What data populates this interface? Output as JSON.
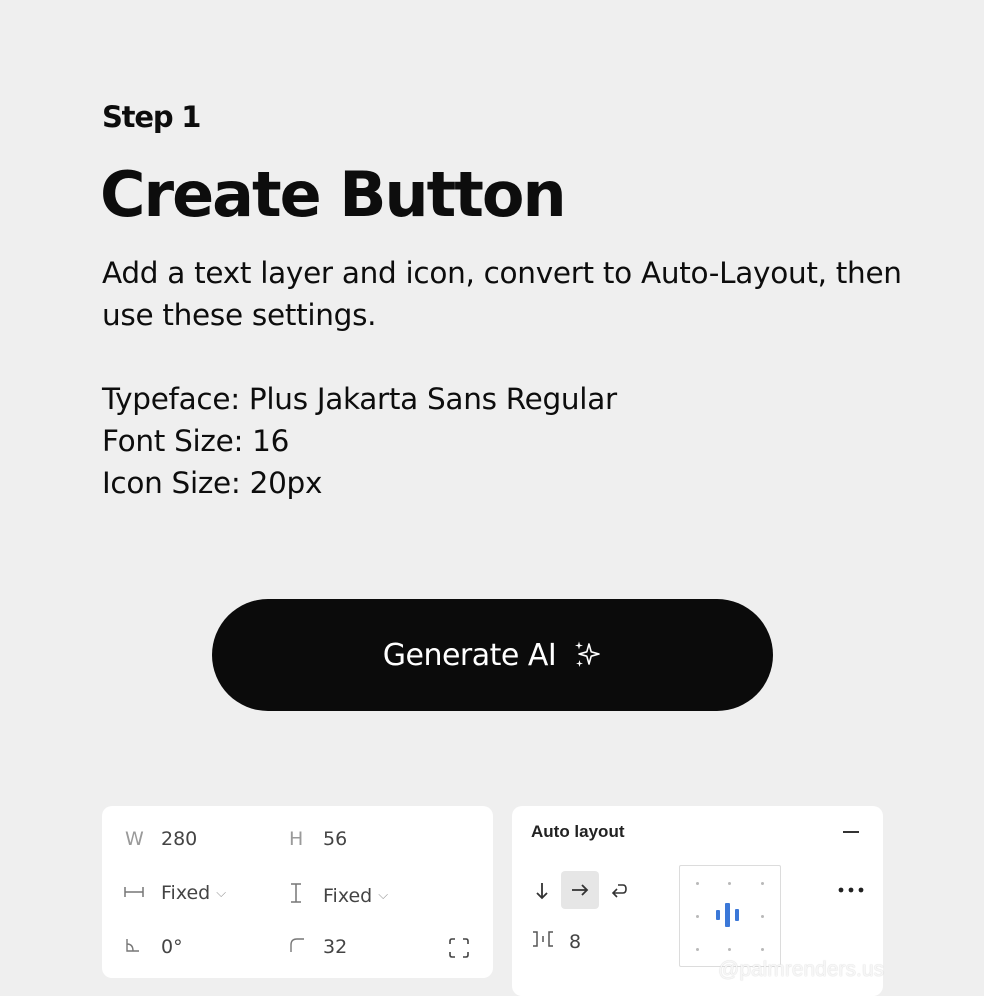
{
  "header": {
    "step": "Step 1",
    "title": "Create Button",
    "description": "Add a text layer and icon, convert to Auto-Layout, then use these settings."
  },
  "specs": [
    "Typeface: Plus Jakarta Sans Regular",
    "Font Size: 16",
    "Icon Size: 20px"
  ],
  "button": {
    "label": "Generate AI",
    "icon": "sparkle-icon"
  },
  "dimensions_panel": {
    "width_prefix": "W",
    "width_value": "280",
    "height_prefix": "H",
    "height_value": "56",
    "width_mode": "Fixed",
    "height_mode": "Fixed",
    "rotation_value": "0°",
    "radius_value": "32"
  },
  "auto_layout_panel": {
    "title": "Auto layout",
    "gap_value": "8",
    "active_direction": "horizontal",
    "accent_color": "#3b78d8"
  },
  "watermark": "@palmrenders.us"
}
